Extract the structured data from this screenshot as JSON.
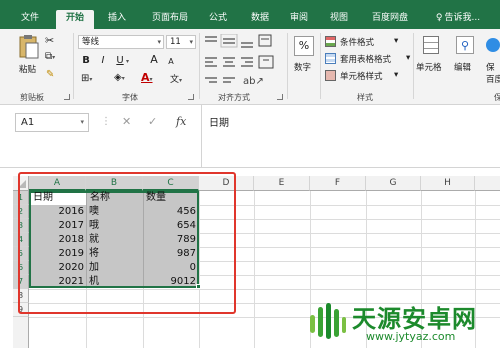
{
  "tabs": [
    "文件",
    "开始",
    "插入",
    "页面布局",
    "公式",
    "数据",
    "审阅",
    "视图",
    "百度网盘",
    "告诉我..."
  ],
  "ribbon": {
    "clipboard": {
      "paste_label": "粘贴",
      "group_label": "剪贴板"
    },
    "font": {
      "font_name": "等线",
      "font_size": "11",
      "bold": "B",
      "italic": "I",
      "underline": "U",
      "grow": "A",
      "shrink": "A",
      "group_label": "字体"
    },
    "alignment": {
      "group_label": "对齐方式"
    },
    "number": {
      "label": "数字"
    },
    "styles": {
      "conditional": "条件格式",
      "table": "套用表格格式",
      "cell_styles": "单元格样式",
      "group_label": "样式"
    },
    "cells": {
      "label": "单元格"
    },
    "editing": {
      "label": "编辑"
    },
    "baidu": {
      "label_1": "保",
      "label_2": "百度"
    },
    "extra_group_label": "保"
  },
  "formula_bar": {
    "name_box": "A1",
    "cancel": "✕",
    "confirm": "✓",
    "fx": "fx",
    "value": "日期"
  },
  "grid": {
    "columns": [
      "A",
      "B",
      "C",
      "D",
      "E",
      "F",
      "G",
      "H"
    ],
    "rows": [
      "1",
      "2",
      "3",
      "4",
      "5",
      "6",
      "7",
      "8",
      "9"
    ],
    "header_row": [
      "日期",
      "名称",
      "数量"
    ],
    "data_rows": [
      [
        "2016",
        "噢",
        "456"
      ],
      [
        "2017",
        "哦",
        "654"
      ],
      [
        "2018",
        "就",
        "789"
      ],
      [
        "2019",
        "将",
        "987"
      ],
      [
        "2020",
        "加",
        "0"
      ],
      [
        "2021",
        "机",
        "9012"
      ]
    ]
  },
  "watermark": {
    "title": "天源安卓网",
    "url": "www.jytyaz.com"
  },
  "colors": {
    "excel_green": "#217346",
    "annotation_red": "#e0362c",
    "watermark_green": "#1c8a2c"
  }
}
